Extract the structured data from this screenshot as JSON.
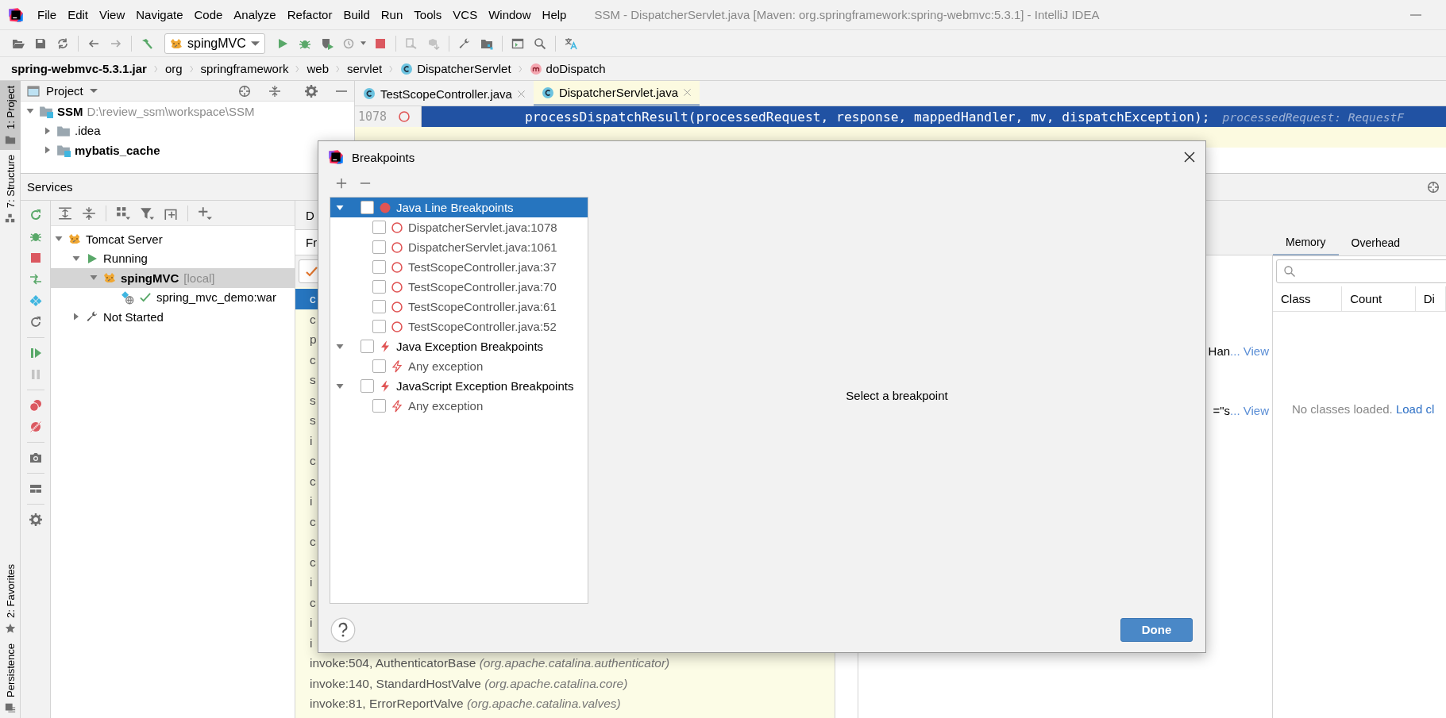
{
  "window": {
    "title": "SSM - DispatcherServlet.java [Maven: org.springframework:spring-webmvc:5.3.1] - IntelliJ IDEA"
  },
  "menu": [
    "File",
    "Edit",
    "View",
    "Navigate",
    "Code",
    "Analyze",
    "Refactor",
    "Build",
    "Run",
    "Tools",
    "VCS",
    "Window",
    "Help"
  ],
  "toolbar": {
    "run_config": "spingMVC"
  },
  "breadcrumbs": [
    {
      "label": "spring-webmvc-5.3.1.jar",
      "kind": "root"
    },
    {
      "label": "org",
      "kind": "package"
    },
    {
      "label": "springframework",
      "kind": "package"
    },
    {
      "label": "web",
      "kind": "package"
    },
    {
      "label": "servlet",
      "kind": "package"
    },
    {
      "label": "DispatcherServlet",
      "kind": "class"
    },
    {
      "label": "doDispatch",
      "kind": "method"
    }
  ],
  "tool_strip": [
    {
      "label": "1: Project",
      "kind": "top",
      "selected": true
    },
    {
      "label": "7: Structure",
      "kind": "top",
      "selected": false
    },
    {
      "label": "2: Favorites",
      "kind": "bottom",
      "selected": false
    },
    {
      "label": "Persistence",
      "kind": "bottom",
      "selected": false
    }
  ],
  "project": {
    "title": "Project",
    "tree": [
      {
        "name": "SSM",
        "path": "D:\\review_ssm\\workspace\\SSM",
        "kind": "module",
        "expanded": true,
        "children": [
          {
            "name": ".idea",
            "kind": "folder",
            "expanded": false
          },
          {
            "name": "mybatis_cache",
            "kind": "module",
            "expanded": false
          }
        ]
      }
    ]
  },
  "editor": {
    "tabs": [
      {
        "label": "TestScopeController.java",
        "selected": false
      },
      {
        "label": "DispatcherServlet.java",
        "selected": true
      }
    ],
    "line": {
      "number": "1078",
      "code": "processDispatchResult(processedRequest, response, mappedHandler, mv, dispatchException);",
      "hint": "processedRequest: RequestF"
    }
  },
  "services": {
    "title": "Services",
    "tree": [
      {
        "label": "Tomcat Server",
        "kind": "server",
        "expanded": true,
        "selected": false,
        "children": [
          {
            "label": "Running",
            "kind": "running",
            "expanded": true,
            "selected": false,
            "children": [
              {
                "label": "spingMVC",
                "note": "[local]",
                "kind": "config",
                "expanded": true,
                "selected": true,
                "children": [
                  {
                    "label": "spring_mvc_demo:war",
                    "kind": "artifact",
                    "selected": false
                  }
                ]
              }
            ]
          },
          {
            "label": "Not Started",
            "kind": "stopped",
            "expanded": false,
            "selected": false
          }
        ]
      }
    ]
  },
  "debugger": {
    "tab": "D",
    "subtab": "Fr",
    "frames": [
      {
        "text": "c",
        "selected": true
      },
      {
        "text": "c",
        "selected": false
      },
      {
        "text": "p",
        "selected": false
      },
      {
        "text": "c",
        "selected": false
      },
      {
        "text": "s",
        "selected": false
      },
      {
        "text": "s",
        "selected": false
      },
      {
        "text": "s",
        "selected": false
      },
      {
        "text": "i",
        "selected": false
      },
      {
        "text": "c",
        "selected": false
      },
      {
        "text": "c",
        "selected": false
      },
      {
        "text": "i",
        "selected": false
      },
      {
        "text": "c",
        "selected": false
      },
      {
        "text": "c",
        "selected": false
      },
      {
        "text": "c",
        "selected": false
      },
      {
        "text": "i",
        "selected": false
      },
      {
        "text": "c",
        "selected": false
      },
      {
        "text": "i",
        "selected": false
      },
      {
        "text": "i",
        "selected": false
      },
      {
        "text": "invoke:504, AuthenticatorBase *(org.apache.catalina.authenticator)*",
        "selected": false
      },
      {
        "text": "invoke:140, StandardHostValve *(org.apache.catalina.core)*",
        "selected": false
      },
      {
        "text": "invoke:81, ErrorReportValve *(org.apache.catalina.valves)*",
        "selected": false
      }
    ]
  },
  "variables": [
    {
      "text": "Han",
      "link": "... View"
    },
    {
      "text": "=\"s",
      "link": "... View"
    }
  ],
  "memory": {
    "tabs": [
      {
        "label": "Memory",
        "selected": true
      },
      {
        "label": "Overhead",
        "selected": false
      }
    ],
    "columns": [
      "Class",
      "Count",
      "Di"
    ],
    "empty_text": "No classes loaded.",
    "empty_link": "Load cl"
  },
  "dialog": {
    "title": "Breakpoints",
    "tree": [
      {
        "label": "Java Line Breakpoints",
        "kind": "line",
        "checked": false,
        "expanded": true,
        "selected": true,
        "children": [
          {
            "label": "DispatcherServlet.java:1078",
            "kind": "line",
            "checked": false,
            "selected": false
          },
          {
            "label": "DispatcherServlet.java:1061",
            "kind": "line",
            "checked": false,
            "selected": false
          },
          {
            "label": "TestScopeController.java:37",
            "kind": "line",
            "checked": false,
            "selected": false
          },
          {
            "label": "TestScopeController.java:70",
            "kind": "line",
            "checked": false,
            "selected": false
          },
          {
            "label": "TestScopeController.java:61",
            "kind": "line",
            "checked": false,
            "selected": false
          },
          {
            "label": "TestScopeController.java:52",
            "kind": "line",
            "checked": false,
            "selected": false
          }
        ]
      },
      {
        "label": "Java Exception Breakpoints",
        "kind": "exception",
        "checked": false,
        "expanded": true,
        "selected": false,
        "children": [
          {
            "label": "Any exception",
            "kind": "exception",
            "checked": false,
            "selected": false
          }
        ]
      },
      {
        "label": "JavaScript Exception Breakpoints",
        "kind": "exception",
        "checked": false,
        "expanded": true,
        "selected": false,
        "children": [
          {
            "label": "Any exception",
            "kind": "exception",
            "checked": false,
            "selected": false
          }
        ]
      }
    ],
    "empty_text": "Select a breakpoint",
    "button": "Done"
  }
}
